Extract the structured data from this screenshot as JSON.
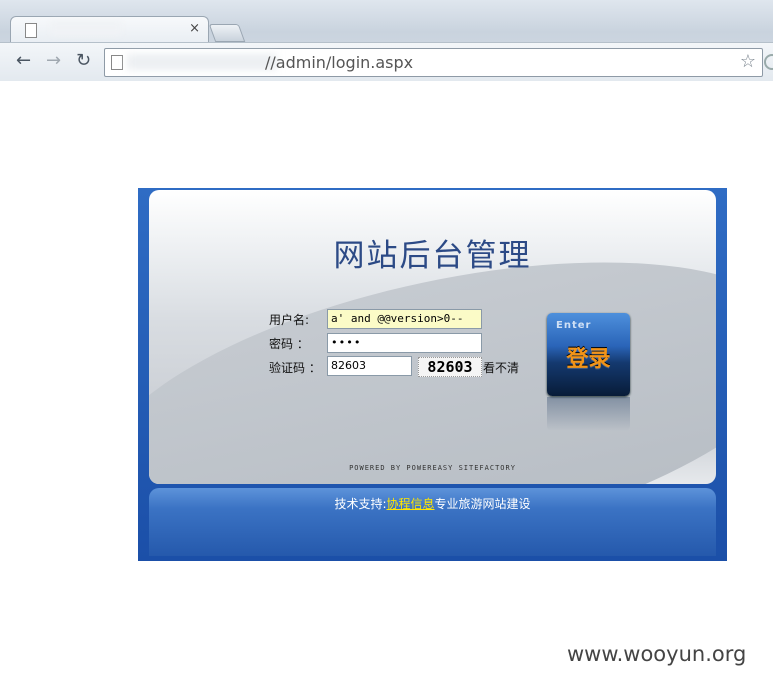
{
  "browser": {
    "tab_title": "",
    "tab_close": "×",
    "url": "//admin/login.aspx",
    "back_icon": "arrow-left",
    "forward_icon": "arrow-right",
    "reload_icon": "reload",
    "star_icon": "star"
  },
  "login": {
    "title": "网站后台管理",
    "username_label": "用户名:",
    "username_value": "a' and @@version>0--",
    "password_label": "密码 ：",
    "password_value": "••••",
    "code_label": "验证码 ：",
    "code_value": "82603",
    "captcha_text": "82603",
    "refresh_label": "看不清",
    "enter_small": "Enter",
    "enter_big": "登录",
    "powered_by": "POWERED BY POWEREASY SITEFACTORY"
  },
  "footer": {
    "prefix": "技术支持:",
    "link": "协程信息",
    "suffix": "专业旅游网站建设"
  },
  "watermark": "www.wooyun.org",
  "colors": {
    "panel_blue": "#1b4fa8",
    "title_blue": "#2c4a86",
    "enter_orange": "#f29418",
    "username_bg": "#fbfbc7",
    "link_yellow": "#ffe600"
  }
}
